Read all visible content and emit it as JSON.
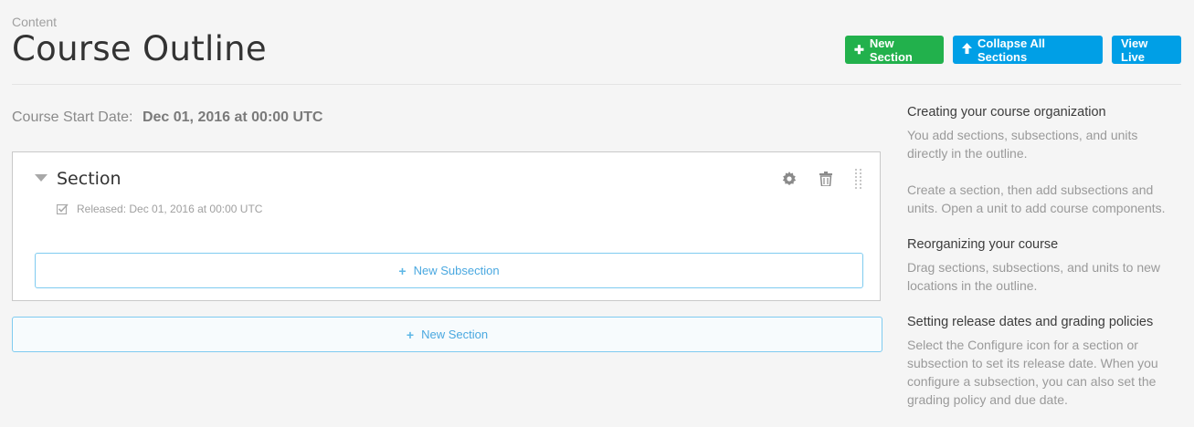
{
  "header": {
    "breadcrumb": "Content",
    "title": "Course Outline",
    "actions": {
      "new_section": "New Section",
      "collapse_all": "Collapse All Sections",
      "view_live": "View Live"
    }
  },
  "course": {
    "start_label": "Course Start Date:",
    "start_value": "Dec 01, 2016 at 00:00 UTC"
  },
  "section": {
    "title": "Section",
    "released": "Released: Dec 01, 2016 at 00:00 UTC",
    "new_subsection": "New Subsection"
  },
  "new_section_bottom": "New Section",
  "sidebar": {
    "blocks": [
      {
        "title": "Creating your course organization",
        "paragraphs": [
          "You add sections, subsections, and units directly in the outline.",
          "Create a section, then add subsections and units. Open a unit to add course components."
        ]
      },
      {
        "title": "Reorganizing your course",
        "paragraphs": [
          "Drag sections, subsections, and units to new locations in the outline."
        ]
      },
      {
        "title": "Setting release dates and grading policies",
        "paragraphs": [
          "Select the Configure icon for a section or subsection to set its release date. When you configure a subsection, you can also set the grading policy and due date."
        ]
      }
    ]
  },
  "colors": {
    "green": "#22b14c",
    "blue": "#009fe6",
    "outline_blue": "#7fcbf0"
  }
}
